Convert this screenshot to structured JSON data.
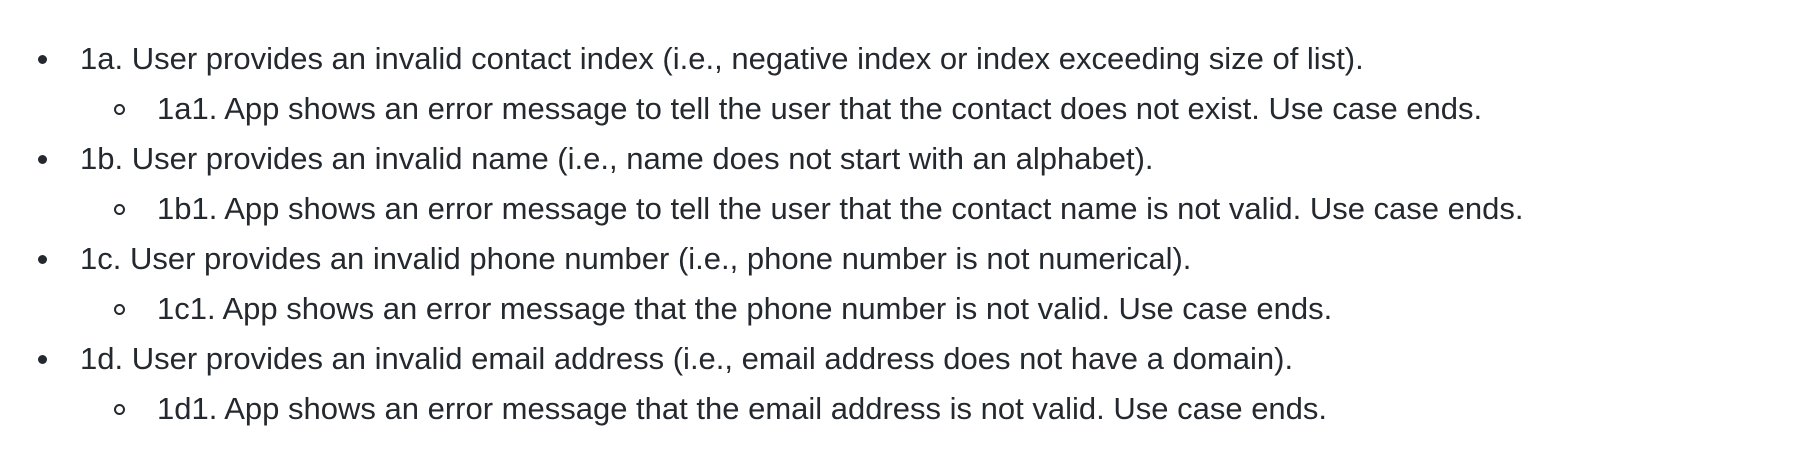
{
  "extensions": [
    {
      "text": "1a. User provides an invalid contact index (i.e., negative index or index exceeding size of list).",
      "sub": "1a1. App shows an error message to tell the user that the contact does not exist. Use case ends."
    },
    {
      "text": "1b. User provides an invalid name (i.e., name does not start with an alphabet).",
      "sub": "1b1. App shows an error message to tell the user that the contact name is not valid. Use case ends."
    },
    {
      "text": "1c. User provides an invalid phone number (i.e., phone number is not numerical).",
      "sub": "1c1. App shows an error message that the phone number is not valid. Use case ends."
    },
    {
      "text": "1d. User provides an invalid email address (i.e., email address does not have a domain).",
      "sub": "1d1. App shows an error message that the email address is not valid. Use case ends."
    }
  ]
}
